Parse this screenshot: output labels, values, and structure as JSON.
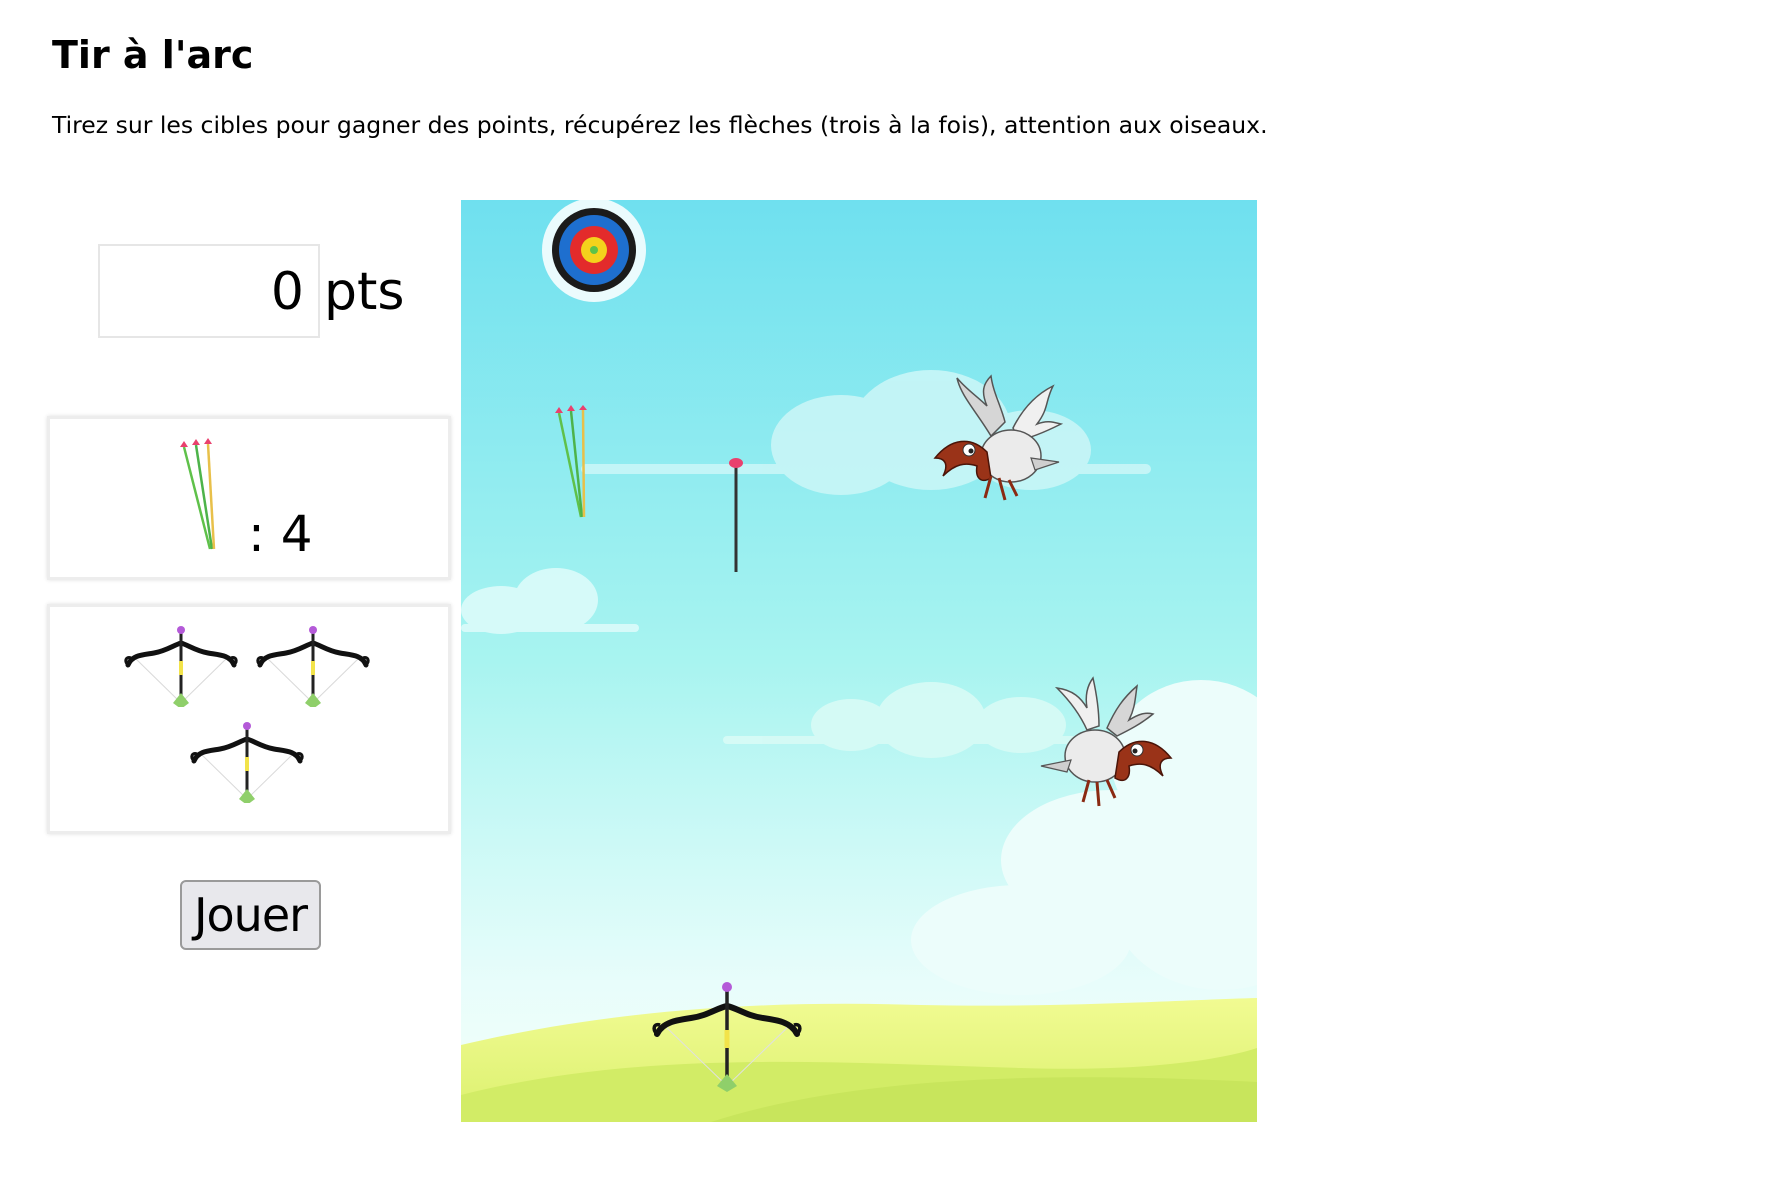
{
  "page": {
    "title": "Tir à l'arc",
    "intro": "Tirez sur les cibles pour gagner des points, récupérez les flèches (trois à la fois), attention aux oiseaux."
  },
  "score": {
    "value": "0",
    "unit": "pts"
  },
  "arrows": {
    "icon": "arrows-bundle-icon",
    "label": ": 4",
    "count": 4
  },
  "lives": {
    "icon": "bow-icon",
    "count": 3
  },
  "controls": {
    "play_label": "Jouer"
  },
  "game": {
    "sky_colors": [
      "#6fe0ef",
      "#a8f4f0",
      "#e8fdfb"
    ],
    "grass_colors": [
      "#eef98a",
      "#d2ec66"
    ],
    "sprites": [
      "target-icon",
      "arrow-bundle-pickup-icon",
      "stuck-arrow-icon",
      "bird-icon",
      "bow-player-icon"
    ]
  }
}
